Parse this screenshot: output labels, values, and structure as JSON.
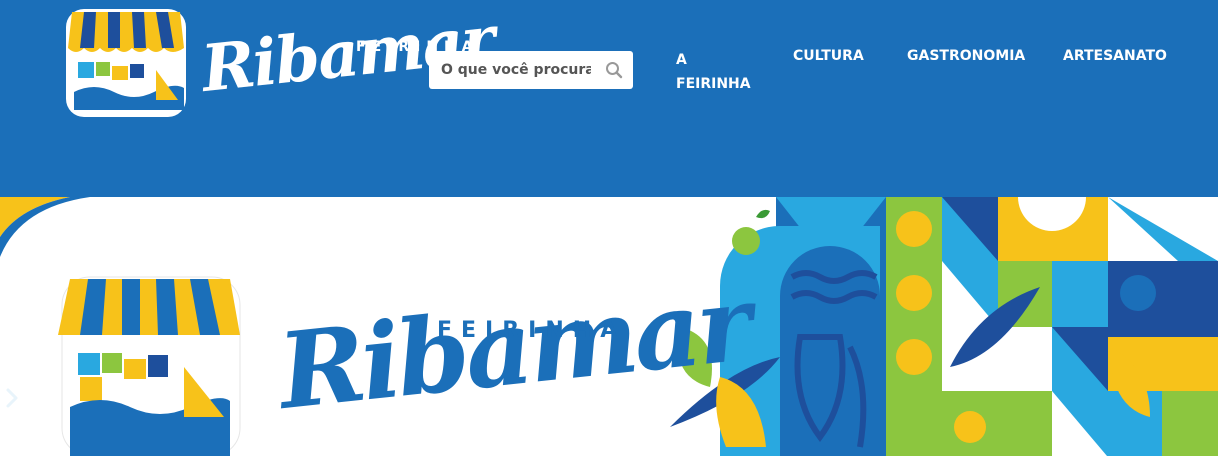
{
  "brand": {
    "word_top": "FEIRINHA",
    "word_main": "Ribamar"
  },
  "search": {
    "placeholder": "O que você procura?"
  },
  "nav": {
    "items": [
      {
        "label_line1": "A",
        "label_line2": "FEIRINHA"
      },
      {
        "label_line1": "CULTURA"
      },
      {
        "label_line1": "GASTRONOMIA"
      },
      {
        "label_line1": "ARTESANATO"
      }
    ]
  },
  "hero": {
    "word_top": "FEIRINHA",
    "word_main": "Ribamar"
  },
  "colors": {
    "header_bg": "#1b6fb9",
    "yellow": "#f7c21a",
    "green": "#8cc63f",
    "light_blue": "#29a8e0",
    "dark_blue": "#1e4f9c"
  },
  "icons": {
    "search": "search-icon",
    "next": "chevron-right-icon"
  }
}
